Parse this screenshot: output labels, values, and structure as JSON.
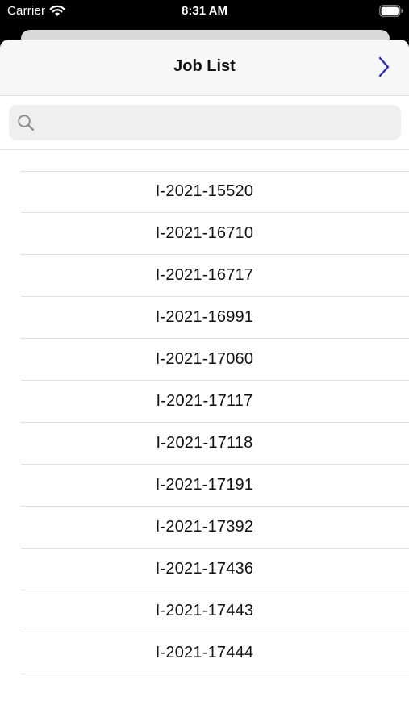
{
  "status_bar": {
    "carrier": "Carrier",
    "time": "8:31 AM"
  },
  "nav": {
    "title": "Job List",
    "next_icon": "chevron-right-icon"
  },
  "search": {
    "placeholder": "",
    "value": "",
    "icon": "search-icon"
  },
  "colors": {
    "accent": "#2c2cd6",
    "status_bar_bg": "#000000",
    "nav_bg": "#f7f7f7",
    "search_bg": "#efeff0"
  },
  "jobs": [
    "I-2021-15520",
    "I-2021-16710",
    "I-2021-16717",
    "I-2021-16991",
    "I-2021-17060",
    "I-2021-17117",
    "I-2021-17118",
    "I-2021-17191",
    "I-2021-17392",
    "I-2021-17436",
    "I-2021-17443",
    "I-2021-17444"
  ]
}
